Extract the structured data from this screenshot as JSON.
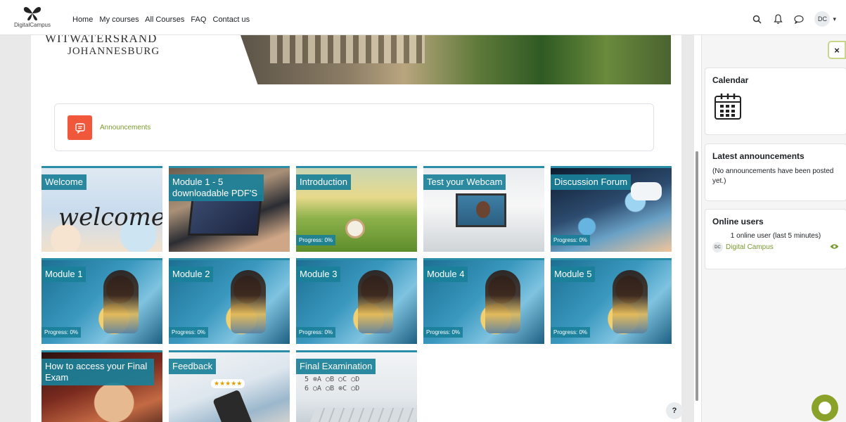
{
  "brand": {
    "logo_text": "DigitalCampus"
  },
  "nav": {
    "items": [
      "Home",
      "My courses",
      "All Courses",
      "FAQ",
      "Contact us"
    ]
  },
  "user": {
    "initials": "DC"
  },
  "banner": {
    "line1": "WITWATERSRAND",
    "line2": "JOHANNESBURG"
  },
  "announcements_card": {
    "label": "Announcements"
  },
  "tiles": [
    {
      "title": "Welcome",
      "progress": ""
    },
    {
      "title": "Module 1 - 5 downloadable PDF'S",
      "progress": ""
    },
    {
      "title": "Introduction",
      "progress": "Progress: 0%"
    },
    {
      "title": "Test your Webcam",
      "progress": ""
    },
    {
      "title": "Discussion Forum",
      "progress": "Progress: 0%"
    },
    {
      "title": "Module 1",
      "progress": "Progress: 0%"
    },
    {
      "title": "Module 2",
      "progress": "Progress: 0%"
    },
    {
      "title": "Module 3",
      "progress": "Progress: 0%"
    },
    {
      "title": "Module 4",
      "progress": "Progress: 0%"
    },
    {
      "title": "Module 5",
      "progress": "Progress: 0%"
    },
    {
      "title": "How to access your Final Exam",
      "progress": ""
    },
    {
      "title": "Feedback",
      "progress": ""
    },
    {
      "title": "Final Examination",
      "progress": ""
    }
  ],
  "drawer": {
    "close_label": "×",
    "calendar": {
      "title": "Calendar"
    },
    "latest_announcements": {
      "title": "Latest announcements",
      "body": "(No announcements have been posted yet.)"
    },
    "online_users": {
      "title": "Online users",
      "count_text": "1 online user (last 5 minutes)",
      "user_initials": "DC",
      "user_name": "Digital Campus"
    }
  },
  "help": {
    "label": "?"
  },
  "colors": {
    "accent": "#1a8099",
    "green": "#7a9a2f",
    "announcement_icon": "#f0573b",
    "chat": "#8aa12a"
  }
}
